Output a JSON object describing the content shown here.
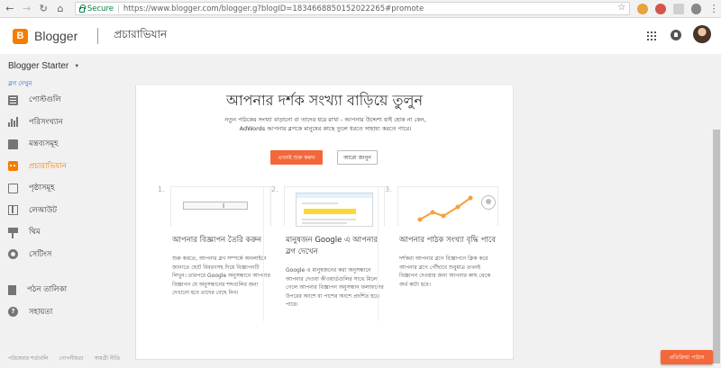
{
  "browser": {
    "secure_label": "Secure",
    "url": "https://www.blogger.com/blogger.g?blogID=1834668850152022265#promote"
  },
  "header": {
    "app_name": "Blogger",
    "page_title": "প্রচারাভিযান"
  },
  "blog": {
    "name": "Blogger Starter",
    "view_blog": "ব্লগ দেখুন"
  },
  "sidebar": {
    "items": [
      {
        "label": "পোস্টগুলি",
        "icon": "posts-icon"
      },
      {
        "label": "পরিসংখ্যান",
        "icon": "stats-icon"
      },
      {
        "label": "মন্তব্যসমূহ",
        "icon": "comments-icon"
      },
      {
        "label": "প্রচারাভিযান",
        "icon": "earnings-icon"
      },
      {
        "label": "পৃষ্ঠাসমূহ",
        "icon": "pages-icon"
      },
      {
        "label": "লেআউট",
        "icon": "layout-icon"
      },
      {
        "label": "থিম",
        "icon": "theme-icon"
      },
      {
        "label": "সেটিংস",
        "icon": "settings-icon"
      }
    ],
    "secondary": [
      {
        "label": "পঠন তালিকা",
        "icon": "reading-list-icon"
      },
      {
        "label": "সহায়তা",
        "icon": "help-icon"
      }
    ],
    "active_color": "#f57d00"
  },
  "footer": {
    "links": [
      "পরিষেবার শর্তাবলি",
      "গোপনীয়তা",
      "সামগ্রী নীতি"
    ]
  },
  "main": {
    "headline": "আপনার দর্শক সংখ্যা বাড়িয়ে তুলুন",
    "intro_line1": "নতুন পাঠকের সংখ্যা বাড়ানো বা তাদের ধরে রাখা - আপনার উদ্দেশ্য যাই হোক না কেন,",
    "intro_line2": "AdWords আপনার ব্লগকে মানুষের কাছে তুলে ধরতে সাহায্য করতে পারে।",
    "primary_button": "এখনই শুরু করুন",
    "secondary_button": "আরো জানুন",
    "steps": [
      {
        "number": "1.",
        "title": "আপনার বিজ্ঞাপন তৈরি করুন",
        "body": "শুরু করতে, আপনার ব্লগ সম্পর্কে অনলাইনে জানাতে ছোট বিবরণসহ দিয়ে বিজ্ঞাপনটি লিখুন। তারপরে Google অনুসন্ধানে আপনার বিজ্ঞাপন যে অনুসন্ধানের শব্দগুলির জন্য দেখানো হবে তাদের বেছে নিন।"
      },
      {
        "number": "2.",
        "title": "মানুষজন Google এ আপনার ব্লগ দেখেন",
        "body": "Google এ মানুষজনের করা অনুসন্ধানে আপনার দেওয়া কীওয়ার্ডগুলির সাথে মিলে গেলে আপনার বিজ্ঞাপন অনুসন্ধান ফলাফলের উপরের অংশে বা পাশের অংশে প্রদর্শিত হতে পারে।"
      },
      {
        "number": "3.",
        "title": "আপনার পাঠক সংখ্যা বৃদ্ধি পাবে",
        "body": "দর্শকরা আপনার ব্লগে বিজ্ঞাপনে ক্লিক করে আপনার ব্লগে পৌঁছাবে শুধুমাত্র তখনই বিজ্ঞাপন দেওয়ার জন্য আপনার কাছ থেকে অর্থ কাটা হবে।"
      }
    ]
  },
  "cta": {
    "label": "প্রতিক্রিয়া পাঠান"
  },
  "colors": {
    "brand": "#f57d00",
    "accent": "#f4673a",
    "link": "#3367d6"
  }
}
